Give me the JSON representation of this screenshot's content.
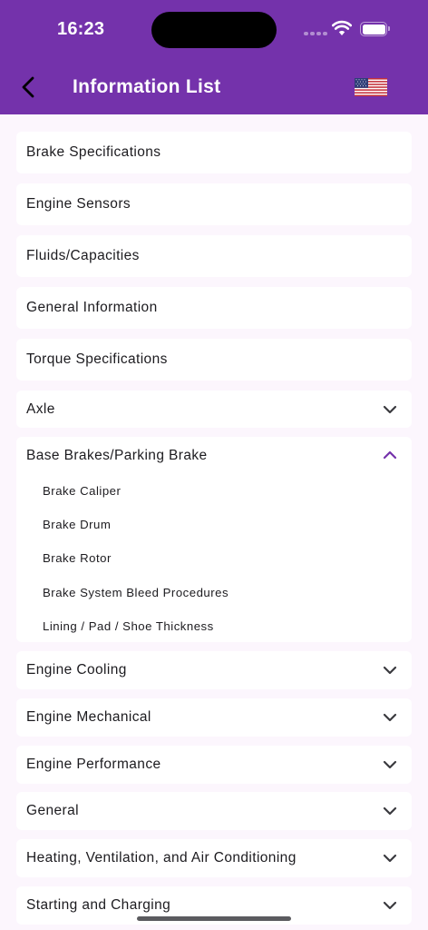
{
  "status_bar": {
    "time": "16:23"
  },
  "header": {
    "title": "Information List",
    "back_icon": "chevron-left-icon",
    "language_icon": "us-flag-icon"
  },
  "items": [
    {
      "label": "Brake Specifications"
    },
    {
      "label": "Engine Sensors"
    },
    {
      "label": "Fluids/Capacities"
    },
    {
      "label": "General Information"
    },
    {
      "label": "Torque Specifications"
    }
  ],
  "categories": [
    {
      "label": "Axle",
      "expanded": false
    },
    {
      "label": "Base Brakes/Parking Brake",
      "expanded": true,
      "children": [
        "Brake Caliper",
        "Brake Drum",
        "Brake Rotor",
        "Brake System Bleed Procedures",
        "Lining / Pad / Shoe Thickness"
      ]
    },
    {
      "label": "Engine Cooling",
      "expanded": false
    },
    {
      "label": "Engine Mechanical",
      "expanded": false
    },
    {
      "label": "Engine Performance",
      "expanded": false
    },
    {
      "label": "General",
      "expanded": false
    },
    {
      "label": "Heating, Ventilation, and Air Conditioning",
      "expanded": false
    },
    {
      "label": "Starting and Charging",
      "expanded": false
    }
  ],
  "colors": {
    "header": "#7432ab",
    "background": "#fcf6fd",
    "expanded_chevron": "#7432ab",
    "chevron": "#3a3a3f"
  }
}
